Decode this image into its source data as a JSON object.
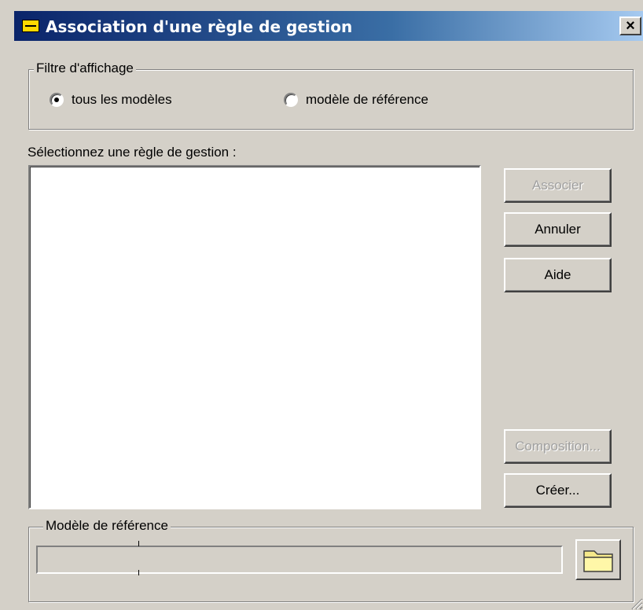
{
  "window": {
    "title": "Association d'une règle de gestion",
    "close_label": "×"
  },
  "filter": {
    "legend": "Filtre d'affichage",
    "options": [
      {
        "label": "tous les modèles",
        "checked": true
      },
      {
        "label": "modèle de référence",
        "checked": false
      }
    ]
  },
  "list": {
    "label": "Sélectionnez une règle de gestion :",
    "items": []
  },
  "buttons": {
    "associate": "Associer",
    "cancel": "Annuler",
    "help": "Aide",
    "composition": "Composition...",
    "create": "Créer..."
  },
  "reference": {
    "legend": "Modèle de référence",
    "path_value": ""
  },
  "icons": {
    "title": "app-icon",
    "folder": "folder-icon",
    "close": "close-icon",
    "grip": "resize-grip-icon"
  }
}
